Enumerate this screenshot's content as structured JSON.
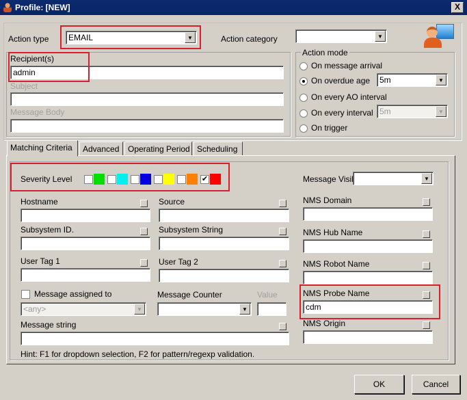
{
  "window": {
    "title": "Profile: [NEW]",
    "close": "X"
  },
  "top": {
    "action_type_label": "Action type",
    "action_type_value": "EMAIL",
    "action_category_label": "Action category",
    "action_category_value": ""
  },
  "email": {
    "recipients_label": "Recipient(s)",
    "recipients_value": "admin",
    "subject_label": "Subject",
    "message_body_label": "Message Body"
  },
  "action_mode": {
    "label": "Action mode",
    "options": [
      "On message arrival",
      "On overdue age",
      "On every AO interval",
      "On every interval",
      "On trigger"
    ],
    "selected": 1,
    "overdue_value": "5m",
    "interval_value": "5m"
  },
  "tabs": [
    "Matching Criteria",
    "Advanced",
    "Operating Period",
    "Scheduling"
  ],
  "criteria": {
    "severity_label": "Severity Level",
    "severity_colors": [
      "#00e000",
      "#00f0f0",
      "#0000e0",
      "#ffff00",
      "#ff8000",
      "#ff0000"
    ],
    "severity_checked": [
      false,
      false,
      false,
      false,
      false,
      true
    ],
    "message_visibility_label": "Message Visibility",
    "hostname": "Hostname",
    "source": "Source",
    "subsystem_id": "Subsystem ID.",
    "subsystem_string": "Subsystem String",
    "user_tag_1": "User Tag 1",
    "user_tag_2": "User Tag 2",
    "message_assigned_to": "Message assigned to",
    "assigned_placeholder": "<any>",
    "message_counter": "Message Counter",
    "value": "Value",
    "message_string": "Message string",
    "nms_domain": "NMS Domain",
    "nms_hub_name": "NMS Hub Name",
    "nms_robot_name": "NMS Robot Name",
    "nms_probe_name": "NMS Probe Name",
    "nms_probe_value": "cdm",
    "nms_origin": "NMS Origin",
    "hint": "Hint: F1 for dropdown selection, F2 for pattern/regexp validation."
  },
  "buttons": {
    "ok": "OK",
    "cancel": "Cancel"
  }
}
